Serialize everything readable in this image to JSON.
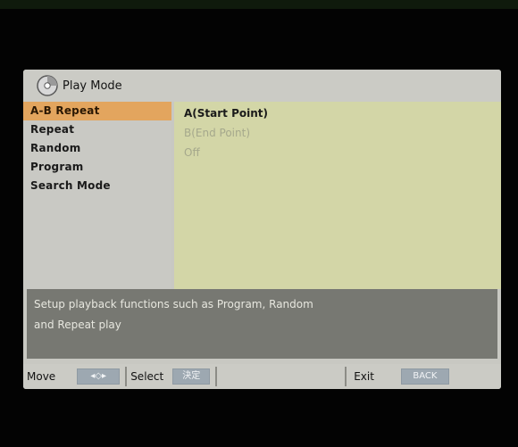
{
  "menu": {
    "title": "Play Mode",
    "icon": "disc-icon",
    "items": [
      {
        "label": "A-B Repeat"
      },
      {
        "label": "Repeat"
      },
      {
        "label": "Random"
      },
      {
        "label": "Program"
      },
      {
        "label": "Search Mode"
      }
    ],
    "active_index": 0
  },
  "options": {
    "items": [
      {
        "label": "A(Start Point)"
      },
      {
        "label": "B(End Point)"
      },
      {
        "label": "Off"
      }
    ],
    "selected_index": 0
  },
  "help": {
    "line1": "Setup playback functions such as Program, Random",
    "line2": "and Repeat play"
  },
  "footer": {
    "move_label": "Move",
    "move_key": "◂◇▸",
    "select_label": "Select",
    "select_key": "決定",
    "exit_label": "Exit",
    "exit_key": "BACK"
  },
  "colors": {
    "active_highlight": "#e3a55e",
    "content_bg": "#d3d6a7",
    "help_bg": "#777872"
  }
}
